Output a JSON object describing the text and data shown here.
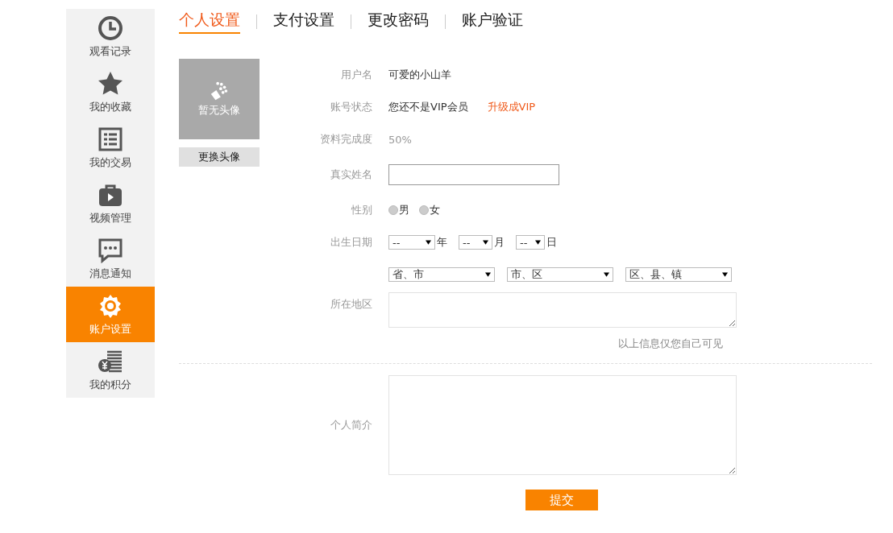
{
  "sidebar": {
    "items": [
      {
        "label": "观看记录",
        "selected": false
      },
      {
        "label": "我的收藏",
        "selected": false
      },
      {
        "label": "我的交易",
        "selected": false
      },
      {
        "label": "视频管理",
        "selected": false
      },
      {
        "label": "消息通知",
        "selected": false
      },
      {
        "label": "账户设置",
        "selected": true
      },
      {
        "label": "我的积分",
        "selected": false
      }
    ]
  },
  "tabs": [
    {
      "label": "个人设置",
      "selected": true
    },
    {
      "label": "支付设置",
      "selected": false
    },
    {
      "label": "更改密码",
      "selected": false
    },
    {
      "label": "账户验证",
      "selected": false
    }
  ],
  "avatar": {
    "placeholder": "暂无头像",
    "button": "更换头像"
  },
  "form": {
    "rows": [
      {
        "kind": "text",
        "label": "用户名",
        "value": "可爱的小山羊"
      },
      {
        "kind": "status",
        "label": "账号状态",
        "value": "您还不是VIP会员",
        "link": "升级成VIP"
      },
      {
        "kind": "muted",
        "label": "资料完成度",
        "value": "50%"
      },
      {
        "kind": "input",
        "label": "真实姓名"
      },
      {
        "kind": "radios",
        "label": "性别",
        "options": [
          {
            "label": "男",
            "checked": false
          },
          {
            "label": "女",
            "checked": false
          }
        ]
      },
      {
        "kind": "date",
        "label": "出生日期",
        "parts": [
          {
            "value": "--",
            "unit": "年"
          },
          {
            "value": "--",
            "unit": "月"
          },
          {
            "value": "--",
            "unit": "日"
          }
        ]
      },
      {
        "kind": "region",
        "selects": [
          "省、市",
          "市、区",
          "区、县、镇"
        ]
      },
      {
        "kind": "textarea",
        "label": "所在地区"
      },
      {
        "kind": "note",
        "text": "以上信息仅您自己可见"
      },
      {
        "kind": "divider"
      },
      {
        "kind": "bigtextarea",
        "label": "个人简介"
      }
    ],
    "submit": "提交"
  }
}
